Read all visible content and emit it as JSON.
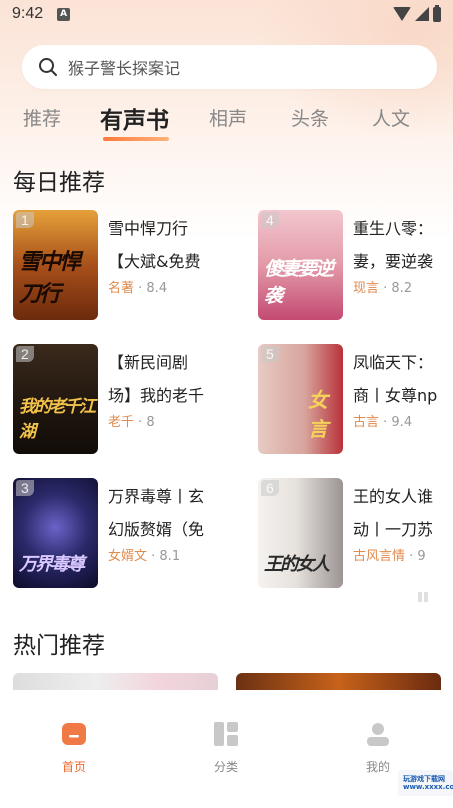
{
  "status": {
    "time": "9:42",
    "a_icon": "A"
  },
  "search": {
    "placeholder": "猴子警长探案记"
  },
  "tabs": [
    {
      "label": "推荐"
    },
    {
      "label": "有声书"
    },
    {
      "label": "相声"
    },
    {
      "label": "头条"
    },
    {
      "label": "人文"
    }
  ],
  "daily": {
    "title": "每日推荐",
    "books": [
      {
        "rank": "1",
        "title_line1": "雪中悍刀行",
        "title_line2": "【大斌&免费",
        "genre": "名著",
        "score": " · 8.4",
        "cover_text": "雪中悍刀行",
        "cover_colors": [
          "#e5a13a",
          "#6c2a0d"
        ]
      },
      {
        "rank": "4",
        "title_line1": "重生八零：",
        "title_line2": "妻，要逆袭",
        "genre": "现言",
        "score": " · 8.2",
        "cover_text": "傻妻要逆袭",
        "cover_colors": [
          "#f2c6ce",
          "#c34a72"
        ]
      },
      {
        "rank": "2",
        "title_line1": "【新民间剧",
        "title_line2": "场】我的老千",
        "genre": "老千",
        "score": " · 8",
        "cover_text": "我的老千江湖",
        "cover_colors": [
          "#3a2a1c",
          "#120c08"
        ]
      },
      {
        "rank": "5",
        "title_line1": "凤临天下：",
        "title_line2": "商丨女尊np",
        "genre": "古言",
        "score": " · 9.4",
        "cover_text": "女言",
        "cover_colors": [
          "#e7cbc4",
          "#b8323a"
        ]
      },
      {
        "rank": "3",
        "title_line1": "万界毒尊丨玄",
        "title_line2": "幻版赘婿（免",
        "genre": "女婿文",
        "score": " · 8.1",
        "cover_text": "万界毒尊",
        "cover_colors": [
          "#2b2a6b",
          "#0c0b2a"
        ]
      },
      {
        "rank": "6",
        "title_line1": "王的女人谁",
        "title_line2": "动丨一刀苏",
        "genre": "古风言情",
        "score": " · 9",
        "cover_text": "王的女人",
        "cover_colors": [
          "#f5f2ef",
          "#9b9493"
        ]
      }
    ]
  },
  "hot": {
    "title": "热门推荐"
  },
  "nav": [
    {
      "label": "首页"
    },
    {
      "label": "分类"
    },
    {
      "label": "我的"
    }
  ],
  "watermark": {
    "line1": "玩游戏下载网",
    "line2": "www.xxxx.com"
  },
  "colors": {
    "accent": "#ee6a2e",
    "genre": "#e08a4e"
  }
}
